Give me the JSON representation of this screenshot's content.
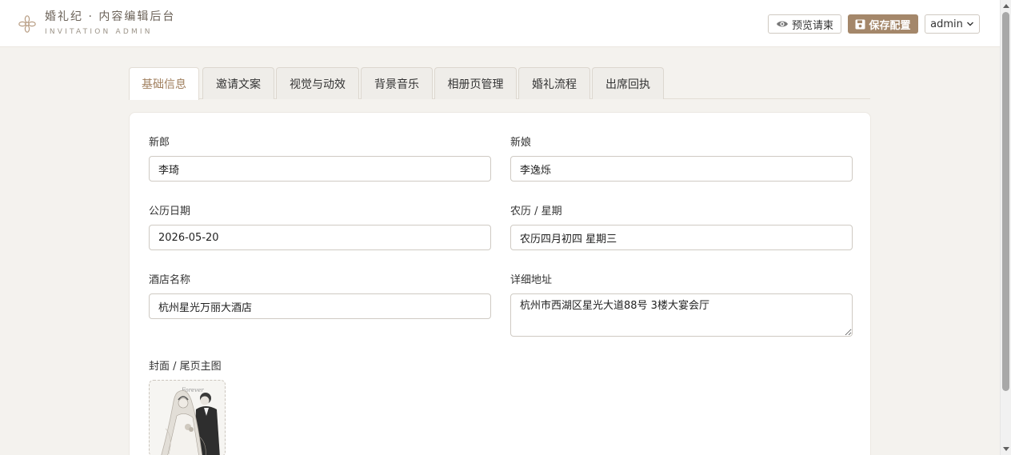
{
  "header": {
    "brand_title": "婚礼纪 · 内容编辑后台",
    "brand_subtitle": "INVITATION ADMIN",
    "brand_icon": "flower-logo-icon",
    "preview_label": "预览请柬",
    "save_label": "保存配置",
    "user_label": "admin",
    "accent_color": "#a4876a"
  },
  "tabs": [
    {
      "label": "基础信息",
      "active": true
    },
    {
      "label": "邀请文案",
      "active": false
    },
    {
      "label": "视觉与动效",
      "active": false
    },
    {
      "label": "背景音乐",
      "active": false
    },
    {
      "label": "相册页管理",
      "active": false
    },
    {
      "label": "婚礼流程",
      "active": false
    },
    {
      "label": "出席回执",
      "active": false
    }
  ],
  "form": {
    "groom": {
      "label": "新郎",
      "value": "李琦"
    },
    "bride": {
      "label": "新娘",
      "value": "李逸烁"
    },
    "date": {
      "label": "公历日期",
      "value": "2026-05-20"
    },
    "lunar": {
      "label": "农历 / 星期",
      "value": "农历四月初四 星期三"
    },
    "hotel": {
      "label": "酒店名称",
      "value": "杭州星光万丽大酒店"
    },
    "address": {
      "label": "详细地址",
      "value": "杭州市西湖区星光大道88号 3楼大宴会厅"
    },
    "cover": {
      "label": "封面 / 尾页主图"
    }
  }
}
